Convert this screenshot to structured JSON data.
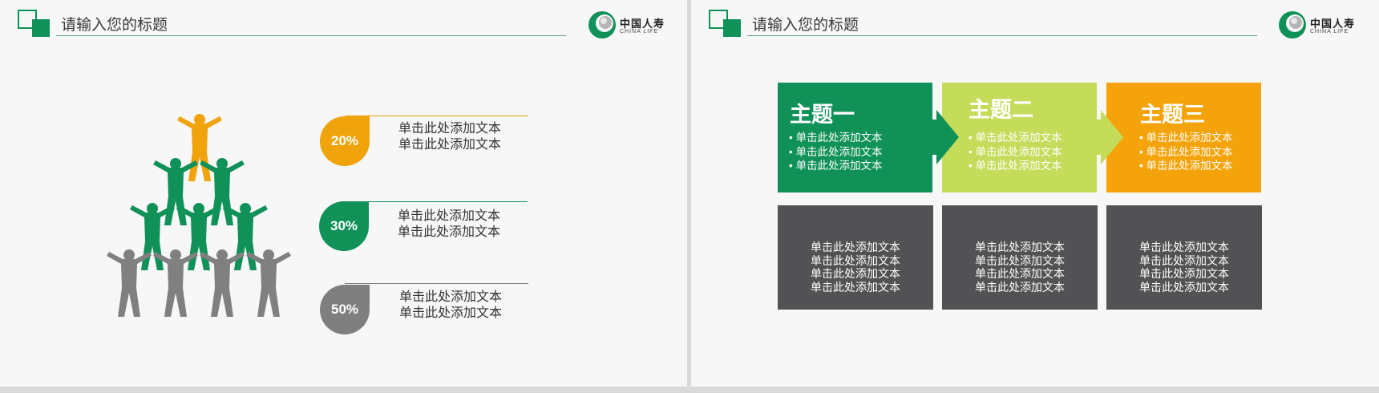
{
  "slide1": {
    "title": "请输入您的标题",
    "logo": {
      "cn": "中国人寿",
      "en": "CHINA  LIFE",
      "icon": "china-life-logo-icon"
    },
    "rows": [
      {
        "pct": "20%",
        "color": "#f0a30a",
        "line1": "单击此处添加文本",
        "line2": "单击此处添加文本"
      },
      {
        "pct": "30%",
        "color": "#0f9158",
        "line1": "单击此处添加文本",
        "line2": "单击此处添加文本"
      },
      {
        "pct": "50%",
        "color": "#7f7f7f",
        "line1": "单击此处添加文本",
        "line2": "单击此处添加文本"
      }
    ],
    "pyramid_colors": {
      "top": "#f0a30a",
      "middle": "#0f9158",
      "bottom": "#808080"
    }
  },
  "slide2": {
    "title": "请输入您的标题",
    "logo": {
      "cn": "中国人寿",
      "en": "CHINA  LIFE",
      "icon": "china-life-logo-icon"
    },
    "topics": [
      {
        "title": "主题一",
        "color": "#0f9158",
        "bullets": [
          "• 单击此处添加文本",
          "• 单击此处添加文本",
          "• 单击此处添加文本"
        ]
      },
      {
        "title": "主题二",
        "color": "#c4dc5a",
        "bullets": [
          "• 单击此处添加文本",
          "• 单击此处添加文本",
          "• 单击此处添加文本"
        ]
      },
      {
        "title": "主题三",
        "color": "#f5a30a",
        "bullets": [
          "• 单击此处添加文本",
          "• 单击此处添加文本",
          "• 单击此处添加文本"
        ]
      }
    ],
    "panels": [
      {
        "lines": [
          "单击此处添加文本",
          "单击此处添加文本",
          "单击此处添加文本",
          "单击此处添加文本"
        ]
      },
      {
        "lines": [
          "单击此处添加文本",
          "单击此处添加文本",
          "单击此处添加文本",
          "单击此处添加文本"
        ]
      },
      {
        "lines": [
          "单击此处添加文本",
          "单击此处添加文本",
          "单击此处添加文本",
          "单击此处添加文本"
        ]
      }
    ],
    "panel_color": "#525255"
  }
}
